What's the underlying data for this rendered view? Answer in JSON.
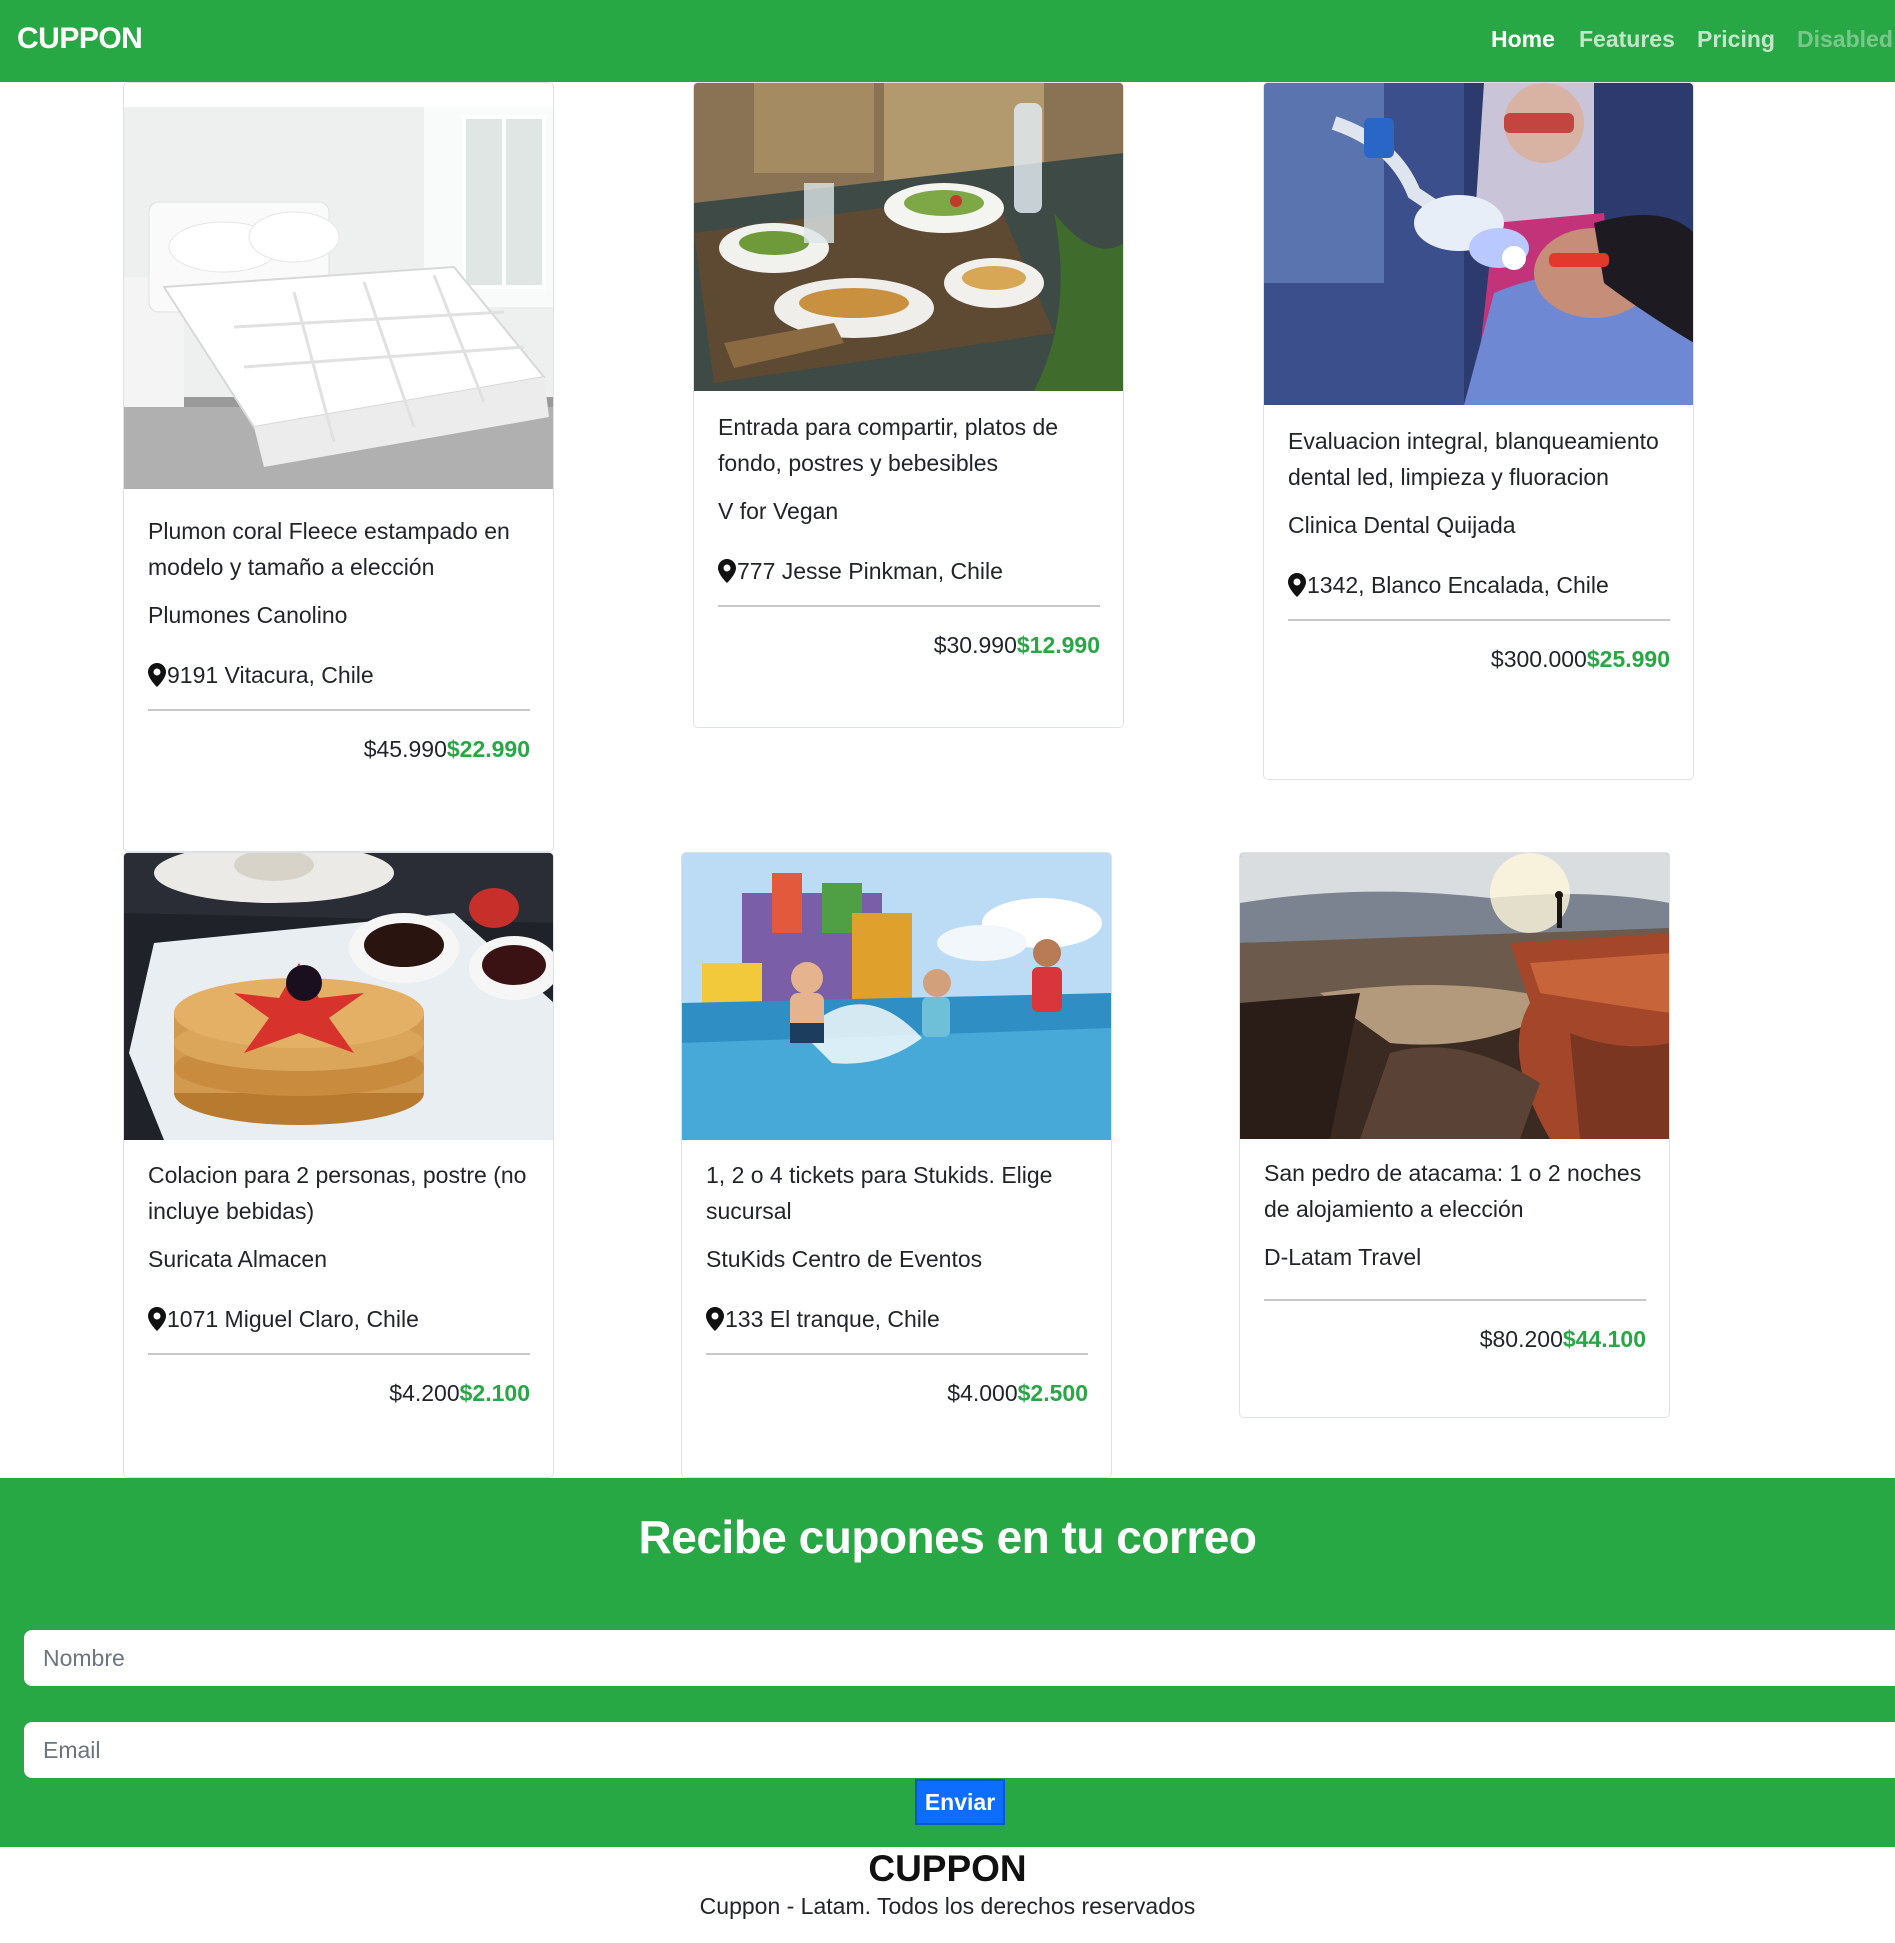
{
  "navbar": {
    "brand": "CUPPON",
    "links": [
      {
        "label": "Home",
        "state": "active"
      },
      {
        "label": "Features",
        "state": "normal"
      },
      {
        "label": "Pricing",
        "state": "normal"
      },
      {
        "label": "Disabled",
        "state": "disabled"
      }
    ]
  },
  "deals": [
    {
      "title": "Plumon coral Fleece estampado en modelo y tamaño a elección",
      "vendor": "Plumones Canolino",
      "address": "9191 Vitacura, Chile",
      "old_price": "$45.990",
      "new_price": "$22.990",
      "image": "white-comforter-bed"
    },
    {
      "title": "Entrada para compartir, platos de fondo, postres y bebesibles",
      "vendor": "V for Vegan",
      "address": "777 Jesse Pinkman, Chile",
      "old_price": "$30.990",
      "new_price": "$12.990",
      "image": "restaurant-table-dishes"
    },
    {
      "title": "Evaluacion integral, blanqueamiento dental led, limpieza y fluoracion",
      "vendor": "Clinica Dental Quijada",
      "address": "1342, Blanco Encalada, Chile",
      "old_price": "$300.000",
      "new_price": "$25.990",
      "image": "dental-whitening-lamp"
    },
    {
      "title": "Colacion para 2 personas, postre (no incluye bebidas)",
      "vendor": "Suricata Almacen",
      "address": "1071 Miguel Claro, Chile",
      "old_price": "$4.200",
      "new_price": "$2.100",
      "image": "pancakes-strawberries"
    },
    {
      "title": "1, 2 o 4 tickets para Stukids. Elige sucursal",
      "vendor": "StuKids Centro de Eventos",
      "address": "133 El tranque, Chile",
      "old_price": "$4.000",
      "new_price": "$2.500",
      "image": "kids-water-park"
    },
    {
      "title": "San pedro de atacama: 1 o 2 noches de alojamiento a elección",
      "vendor": "D-Latam Travel",
      "address": "",
      "old_price": "$80.200",
      "new_price": "$44.100",
      "image": "desert-canyon-sunset"
    }
  ],
  "newsletter": {
    "title": "Recibe cupones en tu correo",
    "name_placeholder": "Nombre",
    "email_placeholder": "Email",
    "submit_label": "Enviar"
  },
  "footer": {
    "brand": "CUPPON",
    "text": "Cuppon - Latam. Todos los derechos reservados"
  },
  "colors": {
    "brand_green": "#28a745",
    "button_blue": "#0d6efd"
  }
}
